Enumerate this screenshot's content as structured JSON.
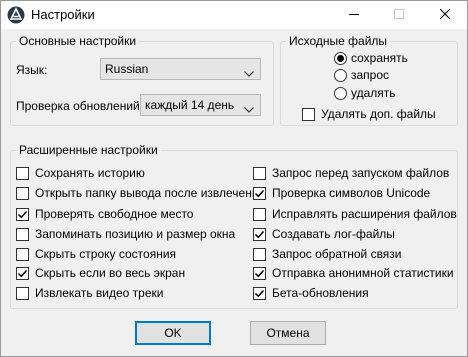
{
  "window": {
    "title": "Настройки",
    "icons": {
      "app": "app-logo-icon",
      "minimize": "minimize-icon",
      "maximize": "maximize-icon",
      "close": "close-icon"
    }
  },
  "basic": {
    "legend": "Основные настройки",
    "language_label": "Язык:",
    "language_value": "Russian",
    "updates_label": "Проверка обновлений:",
    "updates_value": "каждый 14 день"
  },
  "source": {
    "legend": "Исходные файлы",
    "options": [
      {
        "label": "сохранять",
        "selected": true
      },
      {
        "label": "запрос",
        "selected": false
      },
      {
        "label": "удалять",
        "selected": false
      }
    ],
    "delete_extra_label": "Удалять доп. файлы",
    "delete_extra_checked": false
  },
  "advanced": {
    "legend": "Расширенные настройки",
    "left": [
      {
        "label": "Сохранять историю",
        "checked": false
      },
      {
        "label": "Открыть папку вывода после извлечения",
        "checked": false
      },
      {
        "label": "Проверять свободное место",
        "checked": true
      },
      {
        "label": "Запоминать позицию и размер окна",
        "checked": false
      },
      {
        "label": "Скрыть строку состояния",
        "checked": false
      },
      {
        "label": "Скрыть если во весь экран",
        "checked": true
      },
      {
        "label": "Извлекать видео треки",
        "checked": false
      }
    ],
    "right": [
      {
        "label": "Запрос перед запуском файлов",
        "checked": false
      },
      {
        "label": "Проверка символов Unicode",
        "checked": true
      },
      {
        "label": "Исправлять расширения файлов",
        "checked": false
      },
      {
        "label": "Создавать лог-файлы",
        "checked": true
      },
      {
        "label": "Запрос обратной связи",
        "checked": false
      },
      {
        "label": "Отправка анонимной статистики",
        "checked": true
      },
      {
        "label": "Бета-обновления",
        "checked": true
      }
    ]
  },
  "buttons": {
    "ok": "OK",
    "cancel": "Отмена"
  }
}
